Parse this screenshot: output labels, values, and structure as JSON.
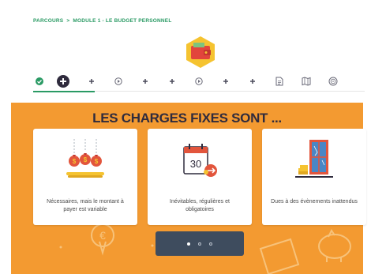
{
  "breadcrumb": {
    "root": "PARCOURS",
    "separator": ">",
    "current": "MODULE 1 - LE BUDGET PERSONNEL"
  },
  "module_icon": "wallet-icon",
  "steps": [
    {
      "icon": "check-icon",
      "state": "done"
    },
    {
      "icon": "plus-icon",
      "state": "current"
    },
    {
      "icon": "plus-icon",
      "state": "upcoming"
    },
    {
      "icon": "play-icon",
      "state": "upcoming"
    },
    {
      "icon": "plus-icon",
      "state": "upcoming"
    },
    {
      "icon": "plus-icon",
      "state": "upcoming"
    },
    {
      "icon": "play-icon",
      "state": "upcoming"
    },
    {
      "icon": "plus-icon",
      "state": "upcoming"
    },
    {
      "icon": "plus-icon",
      "state": "upcoming"
    },
    {
      "icon": "document-icon",
      "state": "upcoming"
    },
    {
      "icon": "map-icon",
      "state": "upcoming"
    },
    {
      "icon": "quiz-icon",
      "state": "upcoming"
    }
  ],
  "section_title": "LES CHARGES FIXES SONT ...",
  "cards": [
    {
      "icon": "money-bags-icon",
      "text": "Nécessaires, mais le montant à payer est variable"
    },
    {
      "icon": "calendar-icon",
      "calendar_day": "30",
      "text": "Inévitables, régulières et obligatoires"
    },
    {
      "icon": "broken-window-icon",
      "text": "Dues à des évènements inattendus"
    }
  ],
  "pager": {
    "count": 3,
    "active": 0
  },
  "colors": {
    "accent_green": "#2a9a64",
    "orange": "#f39a31",
    "dark": "#2f2b3d",
    "pager": "#3e4c5e"
  }
}
